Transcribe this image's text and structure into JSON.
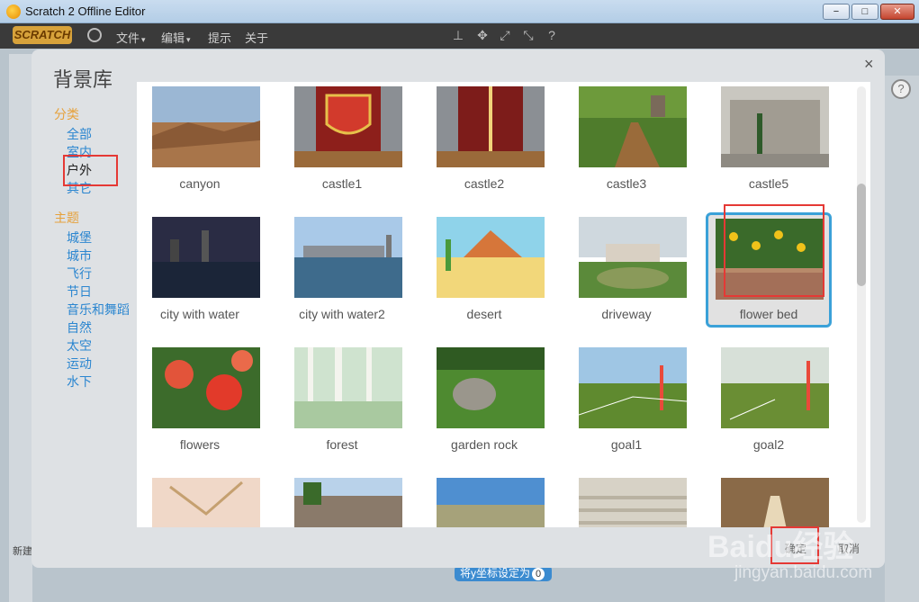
{
  "window": {
    "title": "Scratch 2 Offline Editor",
    "min": "−",
    "max": "□",
    "close": "✕"
  },
  "menubar": {
    "logo": "SCRATCH",
    "items": [
      {
        "label": "文件",
        "dropdown": "▾"
      },
      {
        "label": "编辑",
        "dropdown": "▾"
      },
      {
        "label": "提示"
      },
      {
        "label": "关于"
      }
    ]
  },
  "background_editor": {
    "block_text": "将y坐标设定为",
    "block_value": "0",
    "corner_label": "新建",
    "help": "?"
  },
  "library": {
    "title": "背景库",
    "close": "×",
    "categories_heading": "分类",
    "categories": [
      {
        "label": "全部",
        "selected": false
      },
      {
        "label": "室内",
        "selected": false
      },
      {
        "label": "户外",
        "selected": true
      },
      {
        "label": "其它",
        "selected": false
      }
    ],
    "themes_heading": "主题",
    "themes": [
      "城堡",
      "城市",
      "飞行",
      "节日",
      "音乐和舞蹈",
      "自然",
      "太空",
      "运动",
      "水下"
    ],
    "items": [
      {
        "label": "canyon",
        "selected": false
      },
      {
        "label": "castle1",
        "selected": false
      },
      {
        "label": "castle2",
        "selected": false
      },
      {
        "label": "castle3",
        "selected": false
      },
      {
        "label": "castle5",
        "selected": false
      },
      {
        "label": "city with water",
        "selected": false
      },
      {
        "label": "city with water2",
        "selected": false
      },
      {
        "label": "desert",
        "selected": false
      },
      {
        "label": "driveway",
        "selected": false
      },
      {
        "label": "flower bed",
        "selected": true
      },
      {
        "label": "flowers",
        "selected": false
      },
      {
        "label": "forest",
        "selected": false
      },
      {
        "label": "garden rock",
        "selected": false
      },
      {
        "label": "goal1",
        "selected": false
      },
      {
        "label": "goal2",
        "selected": false
      },
      {
        "label": "",
        "selected": false
      },
      {
        "label": "",
        "selected": false
      },
      {
        "label": "",
        "selected": false
      },
      {
        "label": "",
        "selected": false
      },
      {
        "label": "",
        "selected": false
      }
    ],
    "ok_button": "确定",
    "cancel_button": "取消"
  },
  "watermark": {
    "brand": "Baidu经验",
    "url": "jingyan.baidu.com"
  },
  "colors": {
    "accent": "#3aa1d8",
    "category_heading": "#e6a13b",
    "category_link": "#2b86d0",
    "highlight": "#e53935"
  }
}
